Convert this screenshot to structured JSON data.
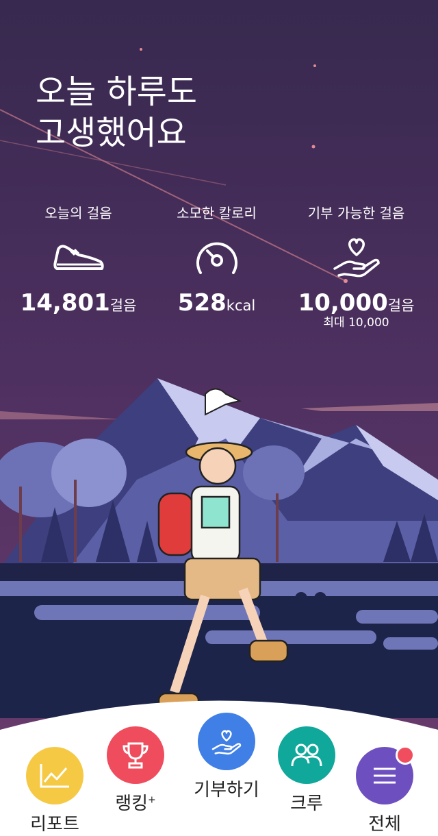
{
  "headline": {
    "line1": "오늘 하루도",
    "line2": "고생했어요"
  },
  "stats": {
    "steps": {
      "label": "오늘의 걸음",
      "value": "14,801",
      "unit": "걸음",
      "icon": "sneaker-icon"
    },
    "calories": {
      "label": "소모한 칼로리",
      "value": "528",
      "unit": "kcal",
      "icon": "gauge-icon"
    },
    "donatable": {
      "label": "기부 가능한 걸음",
      "value": "10,000",
      "unit": "걸음",
      "sub": "최대 10,000",
      "icon": "heart-hand-icon"
    }
  },
  "nav": {
    "report": {
      "label": "리포트",
      "icon": "line-chart-icon",
      "color": "#f6c945"
    },
    "ranking": {
      "label": "랭킹",
      "sup": "+",
      "icon": "trophy-icon",
      "color": "#ef4d5e"
    },
    "donate": {
      "label": "기부하기",
      "icon": "heart-hand-icon",
      "color": "#3f7fe6"
    },
    "crew": {
      "label": "크루",
      "icon": "people-icon",
      "color": "#10a89a"
    },
    "all": {
      "label": "전체",
      "icon": "menu-icon",
      "color": "#6d4fc0",
      "badge_color": "#f04e5e"
    }
  },
  "colors": {
    "sky_top": "#3a2a58",
    "sky_bottom": "#6a3e6e",
    "accent_white": "#ffffff"
  }
}
